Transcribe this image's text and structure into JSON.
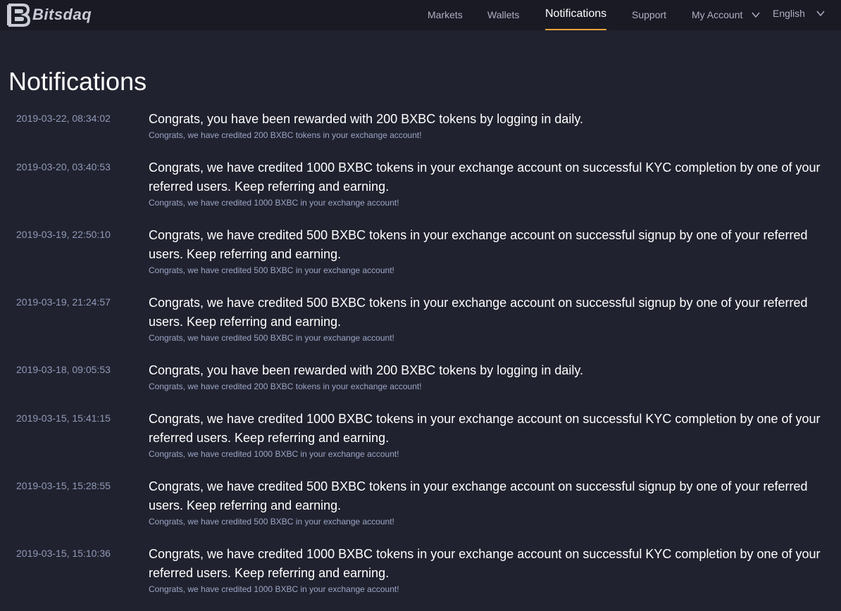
{
  "brand": {
    "name": "Bitsdaq"
  },
  "nav": {
    "markets": "Markets",
    "wallets": "Wallets",
    "notifications": "Notifications",
    "support": "Support",
    "my_account": "My Account",
    "language": "English"
  },
  "colors": {
    "background": "#21222f",
    "topbar": "#191a24",
    "accent": "#e8a43a",
    "timestamp": "#8f9ab8"
  },
  "page": {
    "title": "Notifications"
  },
  "notifications": [
    {
      "time": "2019-03-22, 08:34:02",
      "title": "Congrats, you have been rewarded with 200 BXBC tokens by logging in daily.",
      "subtitle": "Congrats, we have credited 200 BXBC tokens in your exchange account!"
    },
    {
      "time": "2019-03-20, 03:40:53",
      "title": "Congrats, we have credited 1000 BXBC tokens in your exchange account on successful KYC completion by one of your referred users. Keep referring and earning.",
      "subtitle": "Congrats, we have credited 1000 BXBC in your exchange account!"
    },
    {
      "time": "2019-03-19, 22:50:10",
      "title": "Congrats, we have credited 500 BXBC tokens in your exchange account on successful signup by one of your referred users. Keep referring and earning.",
      "subtitle": "Congrats, we have credited 500 BXBC in your exchange account!"
    },
    {
      "time": "2019-03-19, 21:24:57",
      "title": "Congrats, we have credited 500 BXBC tokens in your exchange account on successful signup by one of your referred users. Keep referring and earning.",
      "subtitle": "Congrats, we have credited 500 BXBC in your exchange account!"
    },
    {
      "time": "2019-03-18, 09:05:53",
      "title": "Congrats, you have been rewarded with 200 BXBC tokens by logging in daily.",
      "subtitle": "Congrats, we have credited 200 BXBC tokens in your exchange account!"
    },
    {
      "time": "2019-03-15, 15:41:15",
      "title": "Congrats, we have credited 1000 BXBC tokens in your exchange account on successful KYC completion by one of your referred users. Keep referring and earning.",
      "subtitle": "Congrats, we have credited 1000 BXBC in your exchange account!"
    },
    {
      "time": "2019-03-15, 15:28:55",
      "title": "Congrats, we have credited 500 BXBC tokens in your exchange account on successful signup by one of your referred users. Keep referring and earning.",
      "subtitle": "Congrats, we have credited 500 BXBC in your exchange account!"
    },
    {
      "time": "2019-03-15, 15:10:36",
      "title": "Congrats, we have credited 1000 BXBC tokens in your exchange account on successful KYC completion by one of your referred users. Keep referring and earning.",
      "subtitle": "Congrats, we have credited 1000 BXBC in your exchange account!"
    }
  ]
}
